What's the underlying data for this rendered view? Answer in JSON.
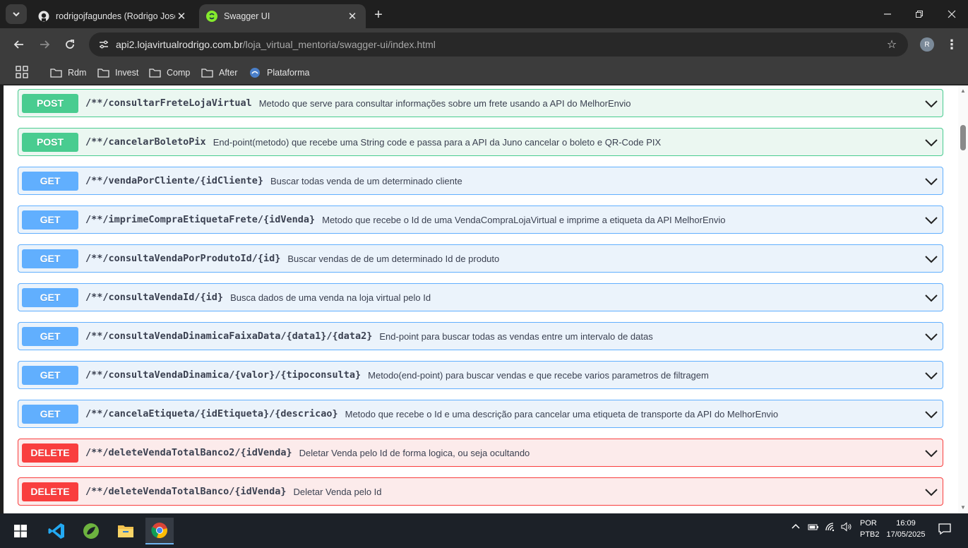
{
  "browser": {
    "tabs": [
      {
        "title": "rodrigojfagundes (Rodrigo Jose",
        "favicon": "github-icon",
        "active": false
      },
      {
        "title": "Swagger UI",
        "favicon": "swagger-icon",
        "active": true
      }
    ],
    "address": {
      "domain": "api2.lojavirtualrodrigo.com.br",
      "path": "/loja_virtual_mentoria/swagger-ui/index.html"
    },
    "profile_initial": "R",
    "bookmarks": [
      {
        "label": "Rdm",
        "icon": "folder-icon"
      },
      {
        "label": "Invest",
        "icon": "folder-icon"
      },
      {
        "label": "Comp",
        "icon": "folder-icon"
      },
      {
        "label": "After",
        "icon": "folder-icon"
      },
      {
        "label": "Plataforma",
        "icon": "site-icon"
      }
    ]
  },
  "operations": [
    {
      "method": "POST",
      "path": "/**/consultarFreteLojaVirtual",
      "summary": "Metodo que serve para consultar informações sobre um frete usando a API do MelhorEnvio"
    },
    {
      "method": "POST",
      "path": "/**/cancelarBoletoPix",
      "summary": "End-point(metodo) que recebe uma String code e passa para a API da Juno cancelar o boleto e QR-Code PIX"
    },
    {
      "method": "GET",
      "path": "/**/vendaPorCliente/{idCliente}",
      "summary": "Buscar todas venda de um determinado cliente"
    },
    {
      "method": "GET",
      "path": "/**/imprimeCompraEtiquetaFrete/{idVenda}",
      "summary": "Metodo que recebe o Id de uma VendaCompraLojaVirtual e imprime a etiqueta da API MelhorEnvio"
    },
    {
      "method": "GET",
      "path": "/**/consultaVendaPorProdutoId/{id}",
      "summary": "Buscar vendas de de um determinado Id de produto"
    },
    {
      "method": "GET",
      "path": "/**/consultaVendaId/{id}",
      "summary": "Busca dados de uma venda na loja virtual pelo Id"
    },
    {
      "method": "GET",
      "path": "/**/consultaVendaDinamicaFaixaData/{data1}/{data2}",
      "summary": "End-point para buscar todas as vendas entre um intervalo de datas"
    },
    {
      "method": "GET",
      "path": "/**/consultaVendaDinamica/{valor}/{tipoconsulta}",
      "summary": "Metodo(end-point) para buscar vendas e que recebe varios parametros de filtragem"
    },
    {
      "method": "GET",
      "path": "/**/cancelaEtiqueta/{idEtiqueta}/{descricao}",
      "summary": "Metodo que recebe o Id e uma descrição para cancelar uma etiqueta de transporte da API do MelhorEnvio"
    },
    {
      "method": "DELETE",
      "path": "/**/deleteVendaTotalBanco2/{idVenda}",
      "summary": "Deletar Venda pelo Id de forma logica, ou seja ocultando"
    },
    {
      "method": "DELETE",
      "path": "/**/deleteVendaTotalBanco/{idVenda}",
      "summary": "Deletar Venda pelo Id"
    }
  ],
  "colors": {
    "post": "#49cc90",
    "get": "#61affe",
    "delete": "#f93e3e"
  },
  "taskbar": {
    "apps": [
      "windows-start-icon",
      "vscode-icon",
      "spring-tools-icon",
      "file-explorer-icon",
      "chrome-icon"
    ],
    "lang_line1": "POR",
    "lang_line2": "PTB2",
    "time": "16:09",
    "date": "17/05/2025"
  }
}
